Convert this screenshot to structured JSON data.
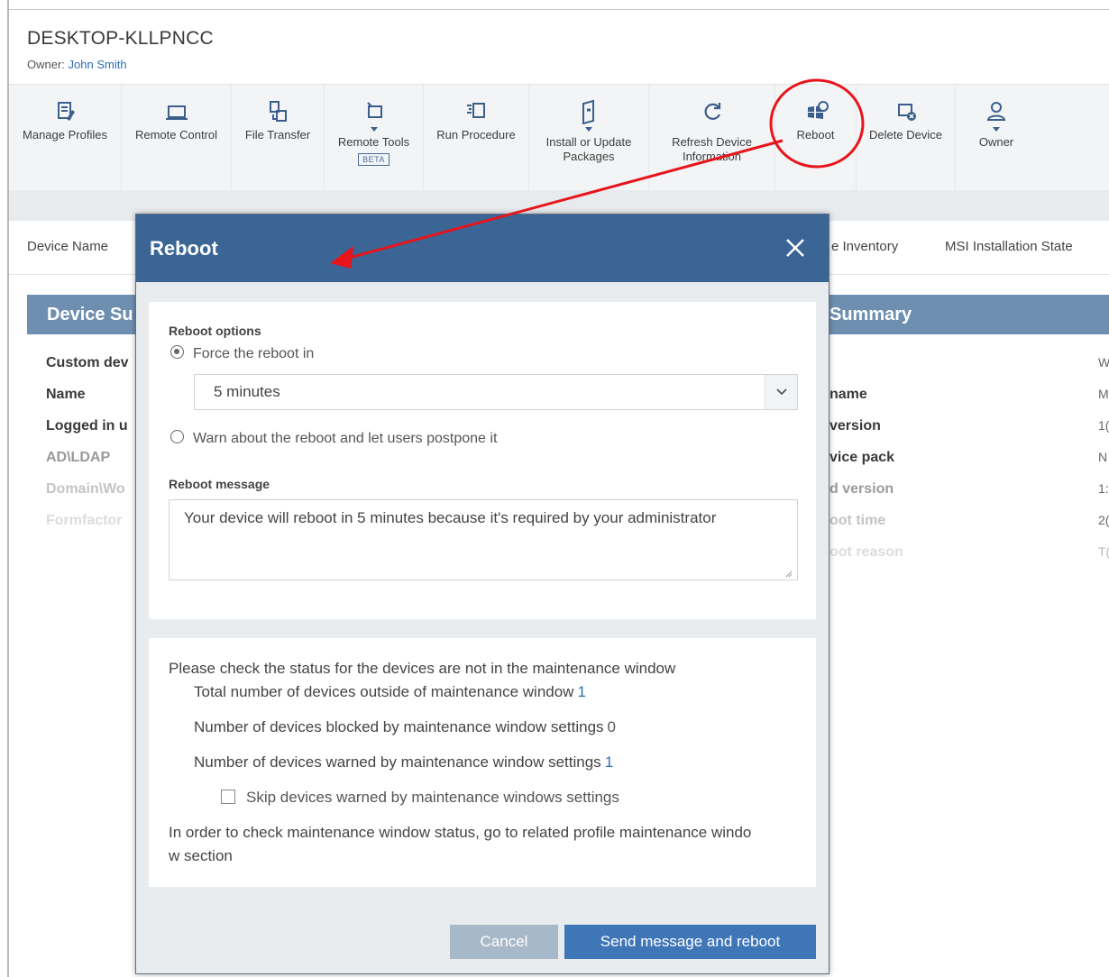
{
  "device": {
    "name": "DESKTOP-KLLPNCC",
    "owner_label": "Owner:",
    "owner_name": "John Smith"
  },
  "toolbar": {
    "items": [
      {
        "label": "Manage Profiles",
        "icon": "manage-profiles-icon"
      },
      {
        "label": "Remote Control",
        "icon": "laptop-icon"
      },
      {
        "label": "File Transfer",
        "icon": "file-transfer-icon"
      },
      {
        "label": "Remote Tools",
        "icon": "remote-tools-icon",
        "badge": "BETA"
      },
      {
        "label": "Run Procedure",
        "icon": "run-procedure-icon"
      },
      {
        "label_line1": "Install or Update",
        "label_line2": "Packages",
        "icon": "package-icon"
      },
      {
        "label_line1": "Refresh Device",
        "label_line2": "Information",
        "icon": "refresh-icon"
      },
      {
        "label": "Reboot",
        "icon": "reboot-icon"
      },
      {
        "label": "Delete Device",
        "icon": "delete-device-icon"
      },
      {
        "label": "Owner",
        "icon": "owner-icon"
      }
    ]
  },
  "tabs": {
    "device_name": "Device Name",
    "inventory_partial": "e Inventory",
    "msi_state": "MSI Installation State"
  },
  "background": {
    "panel_left_title": "Device Su",
    "panel_right_title": "Summary",
    "left_rows": [
      "Custom dev",
      "Name",
      "Logged in u",
      "AD\\LDAP",
      "Domain\\Wo",
      "Formfactor"
    ],
    "right_rows": [
      "name",
      "version",
      "vice pack",
      "d version",
      "oot time",
      "oot reason"
    ],
    "right_values": [
      "W",
      "M",
      "1(",
      "N",
      "1:",
      "2(",
      "T("
    ]
  },
  "modal": {
    "title": "Reboot",
    "reboot_options_label": "Reboot options",
    "force_option": "Force the reboot in",
    "force_selected": true,
    "delay_value": "5 minutes",
    "warn_option": "Warn about the reboot and let users postpone it",
    "reboot_message_label": "Reboot message",
    "reboot_message": "Your device will reboot in 5 minutes because it's required by your administrator",
    "status_intro": "Please check the status for the devices are not in the maintenance window",
    "total_outside_label": "Total number of devices outside of maintenance window",
    "total_outside_value": "1",
    "blocked_label": "Number of devices blocked by maintenance window settings",
    "blocked_value": "0",
    "warned_label": "Number of devices warned by maintenance window settings",
    "warned_value": "1",
    "skip_label": "Skip devices warned by maintenance windows settings",
    "skip_checked": false,
    "footer_note_line1": "In order to check maintenance window status, go to related profile maintenance windo",
    "footer_note_line2": "w section",
    "cancel_label": "Cancel",
    "send_label": "Send message and reboot"
  },
  "colors": {
    "modal_header": "#3a6595",
    "primary_button": "#3f76b8",
    "cancel_button": "#a7b8c9",
    "link": "#2f6db5",
    "annotation": "#e8141c"
  }
}
